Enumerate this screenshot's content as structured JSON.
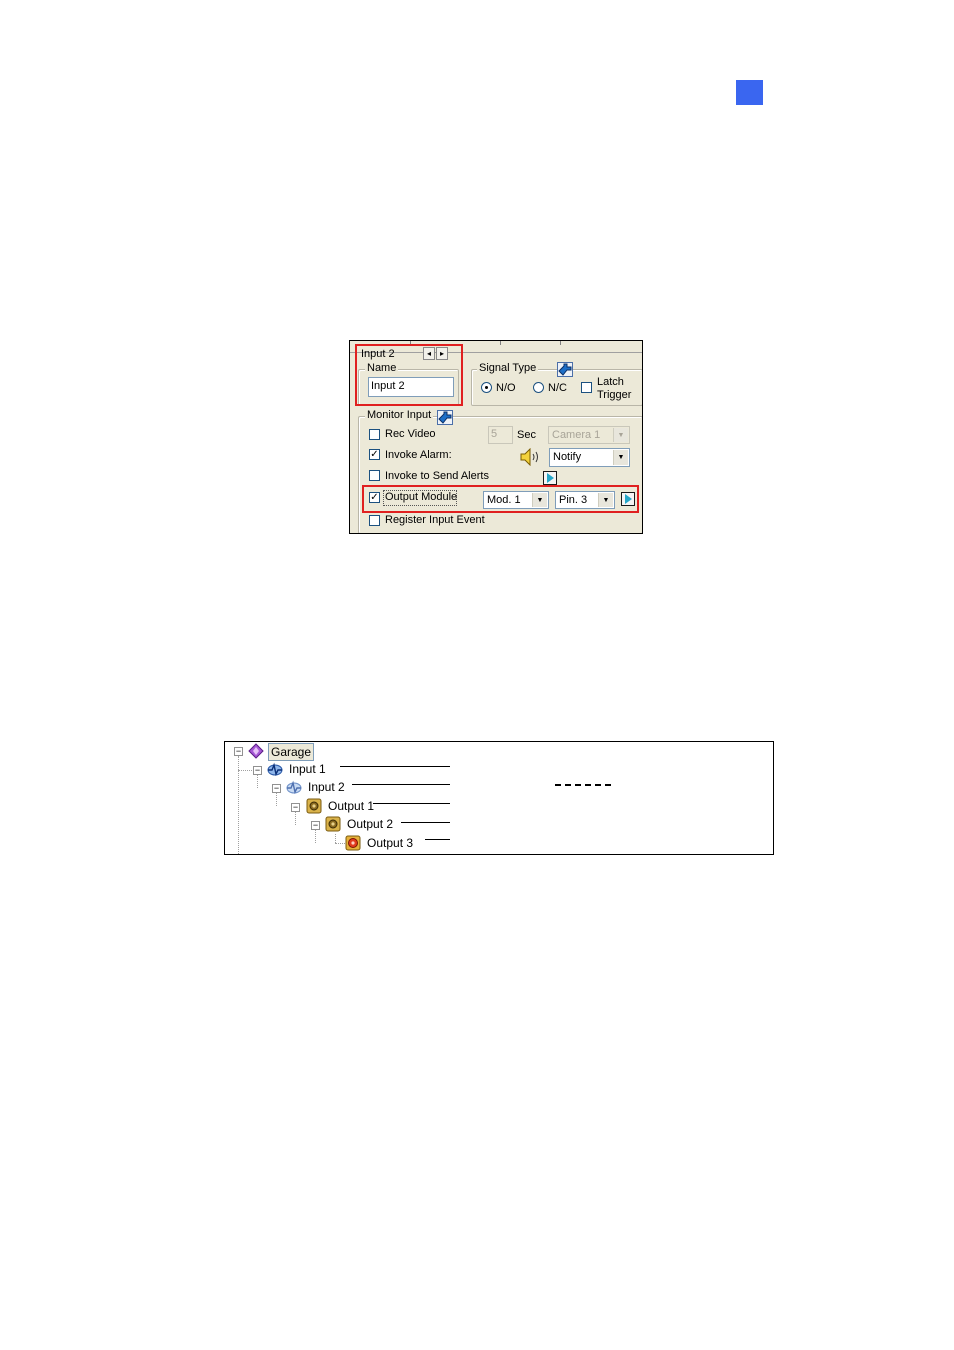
{
  "page": {
    "accent_color": "#3a66f0"
  },
  "dialog": {
    "input_tab": {
      "label": "Input 2",
      "prev_icon": "left-arrow-icon",
      "next_icon": "right-arrow-icon"
    },
    "name": {
      "group_label": "Name",
      "value": "Input 2"
    },
    "signal_type": {
      "group_label": "Signal Type",
      "button_icon": "hand-pointer-icon",
      "options": [
        "N/O",
        "N/C"
      ],
      "selected": "N/O",
      "latch_label_line1": "Latch",
      "latch_label_line2": "Trigger",
      "latch_checked": false
    },
    "monitor_input": {
      "group_label": "Monitor Input",
      "button_icon": "hand-pointer-icon",
      "rec_video": {
        "label": "Rec Video",
        "checked": false,
        "seconds_value": "5",
        "seconds_unit": "Sec",
        "camera": "Camera 1"
      },
      "invoke_alarm": {
        "label": "Invoke Alarm:",
        "checked": true,
        "speaker_icon": "speaker-icon",
        "sound": "Notify"
      },
      "invoke_alerts": {
        "label": "Invoke to Send Alerts",
        "checked": false,
        "settings_icon": "play-arrow-icon"
      },
      "output_module": {
        "label": "Output Module",
        "checked": true,
        "module": "Mod. 1",
        "pin": "Pin. 3",
        "settings_icon": "play-arrow-icon"
      },
      "register_event": {
        "label": "Register Input Event",
        "checked": false
      }
    },
    "highlight_color": "#e02020"
  },
  "tree": {
    "nodes": [
      {
        "label": "Garage",
        "icon": "garage-diamond-icon",
        "expand": "⊟"
      },
      {
        "label": "Input 1",
        "icon": "input-pulse-icon",
        "expand": "⊟"
      },
      {
        "label": "Input 2",
        "icon": "input-pulse-icon",
        "expand": "⊟"
      },
      {
        "label": "Output 1",
        "icon": "output-module-icon",
        "expand": "⊟"
      },
      {
        "label": "Output 2",
        "icon": "output-module-icon",
        "expand": "⊟"
      },
      {
        "label": "Output 3",
        "icon": "output-alarm-icon",
        "expand": ""
      }
    ]
  }
}
